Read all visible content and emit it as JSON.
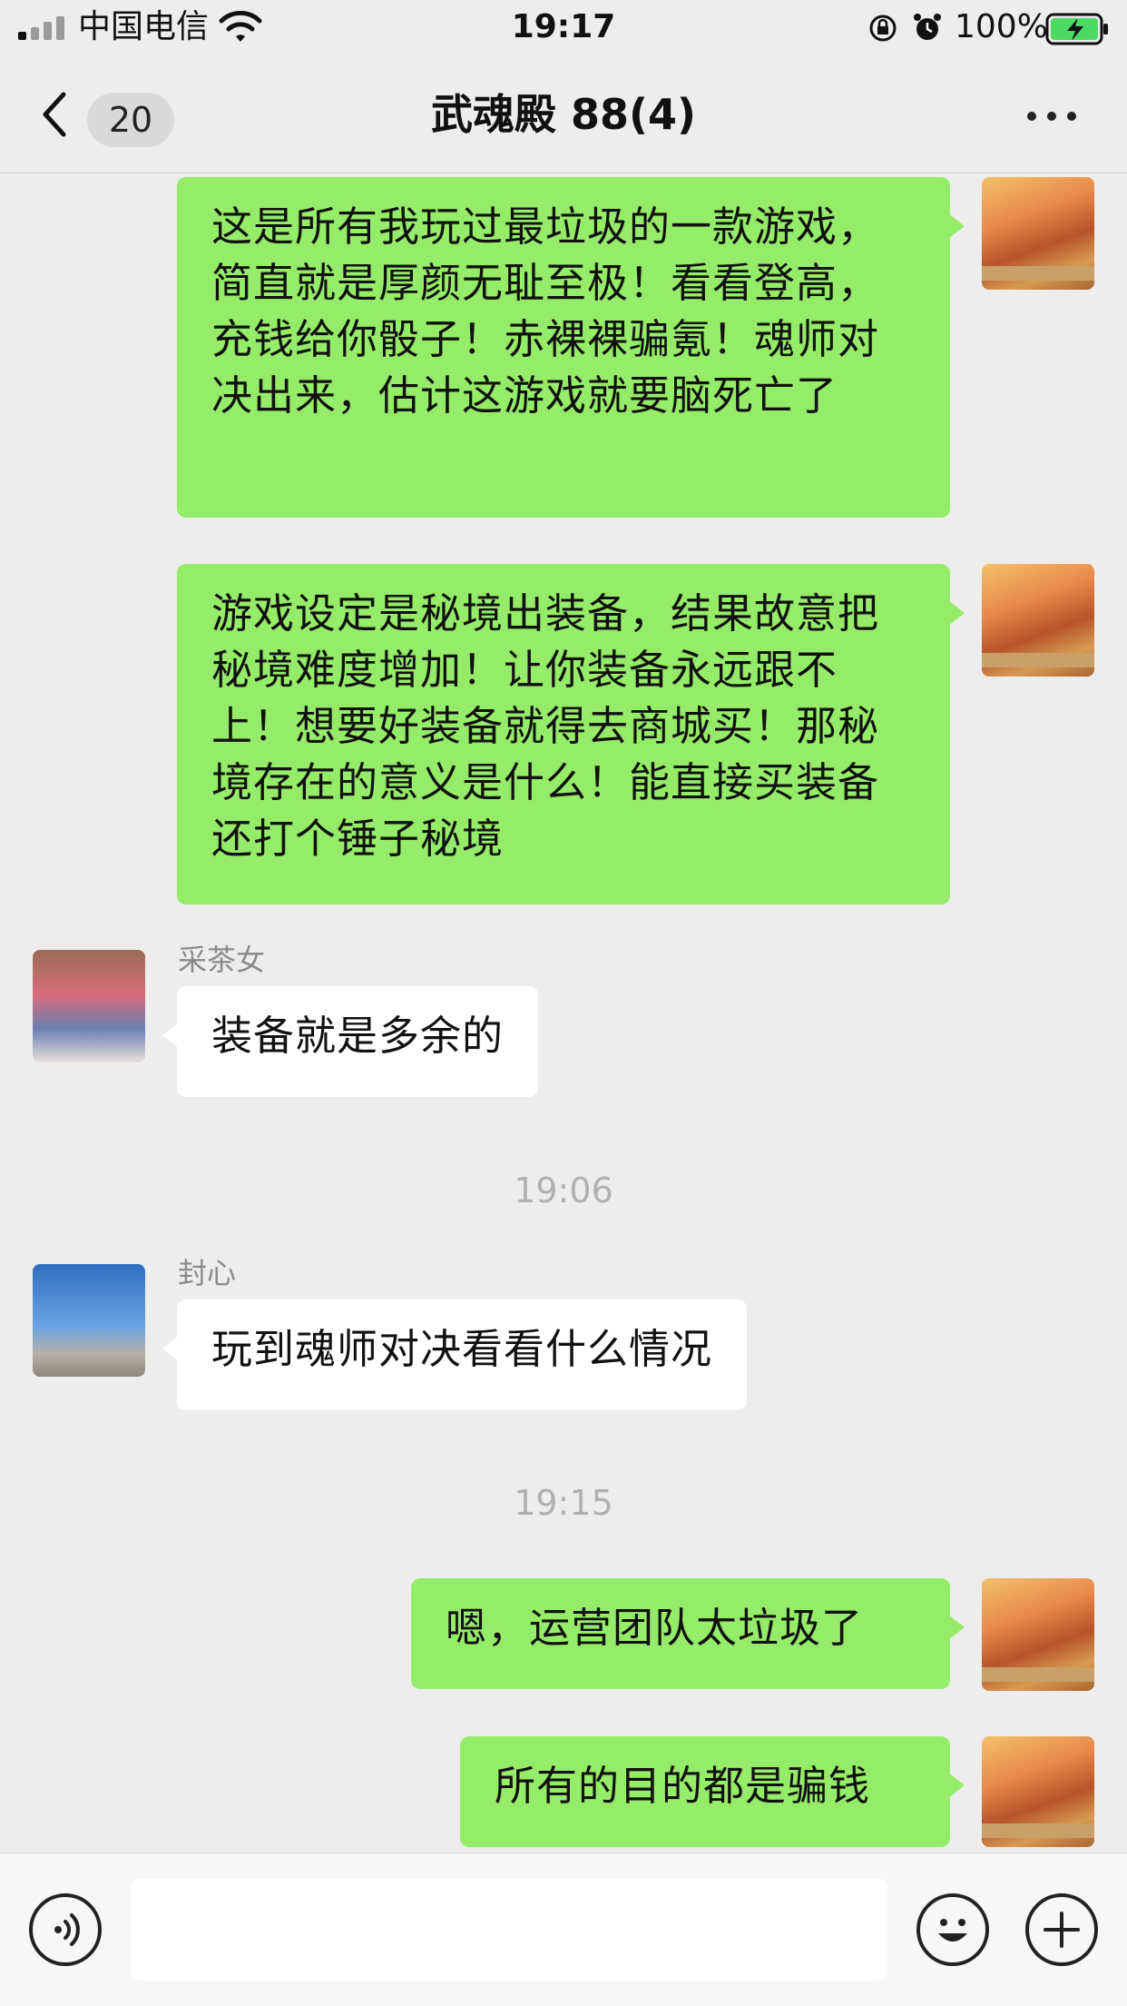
{
  "status_bar": {
    "carrier": "中国电信",
    "time": "19:17",
    "battery_percent": "100%",
    "signal_bars_active": 1,
    "signal_bars_total": 4
  },
  "nav": {
    "unread_count": "20",
    "title": "武魂殿 88(4)"
  },
  "messages": [
    {
      "direction": "out",
      "text": "这是所有我玩过最垃圾的一款游戏，简直就是厚颜无耻至极！看看登高，充钱给你骰子！赤裸裸骗氪！魂师对决出来，估计这游戏就要脑死亡了"
    },
    {
      "direction": "out",
      "text": "游戏设定是秘境出装备，结果故意把秘境难度增加！让你装备永远跟不上！想要好装备就得去商城买！那秘境存在的意义是什么！能直接买装备还打个锤子秘境"
    },
    {
      "direction": "in",
      "sender": "采茶女",
      "text": "装备就是多余的"
    },
    {
      "timestamp": "19:06"
    },
    {
      "direction": "in",
      "sender": "封心",
      "text": "玩到魂师对决看看什么情况"
    },
    {
      "timestamp": "19:15"
    },
    {
      "direction": "out",
      "text": "嗯，运营团队太垃圾了"
    },
    {
      "direction": "out",
      "text": "所有的目的都是骗钱"
    }
  ],
  "input": {
    "placeholder": "",
    "value": ""
  },
  "colors": {
    "background": "#ededed",
    "outgoing_bubble": "#95ec69",
    "incoming_bubble": "#ffffff",
    "battery_fill": "#4cd964"
  },
  "icons": {
    "back": "chevron-left-icon",
    "more": "more-dots-icon",
    "voice": "voice-icon",
    "emoji": "emoji-icon",
    "plus": "plus-icon"
  }
}
